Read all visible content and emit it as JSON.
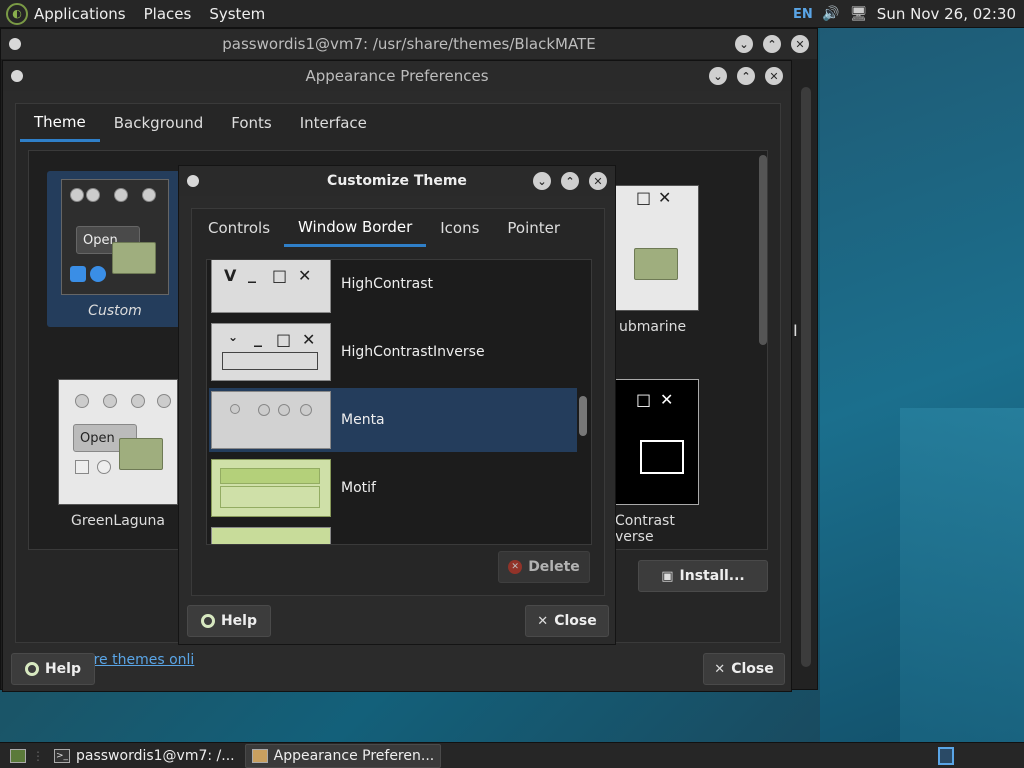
{
  "top_panel": {
    "menus": [
      "Applications",
      "Places",
      "System"
    ],
    "keyboard": "EN",
    "clock": "Sun Nov 26, 02:30"
  },
  "terminal": {
    "title": "passwordis1@vm7: /usr/share/themes/BlackMATE"
  },
  "appearance": {
    "title": "Appearance Preferences",
    "tabs": [
      "Theme",
      "Background",
      "Fonts",
      "Interface"
    ],
    "themes": [
      {
        "name": "Custom",
        "selected": true
      },
      {
        "name": "GreenLaguna",
        "selected": false
      },
      {
        "name": "ubmarine",
        "selected": false
      },
      {
        "name": "Contrast\nverse",
        "selected": false
      }
    ],
    "link": "Get more themes onli",
    "install_label": "Install...",
    "help_label": "Help",
    "close_label": "Close"
  },
  "customize": {
    "title": "Customize Theme",
    "tabs": [
      "Controls",
      "Window Border",
      "Icons",
      "Pointer"
    ],
    "selected_tab": "Window Border",
    "borders": [
      {
        "name": "HighContrast",
        "selected": false
      },
      {
        "name": "HighContrastInverse",
        "selected": false
      },
      {
        "name": "Menta",
        "selected": true
      },
      {
        "name": "Motif",
        "selected": false
      }
    ],
    "delete_label": "Delete",
    "help_label": "Help",
    "close_label": "Close"
  },
  "taskbar": {
    "items": [
      "passwordis1@vm7: /...",
      "Appearance Preferen..."
    ]
  },
  "colors": {
    "accent": "#2f7fc8",
    "selection": "#243d5c"
  }
}
